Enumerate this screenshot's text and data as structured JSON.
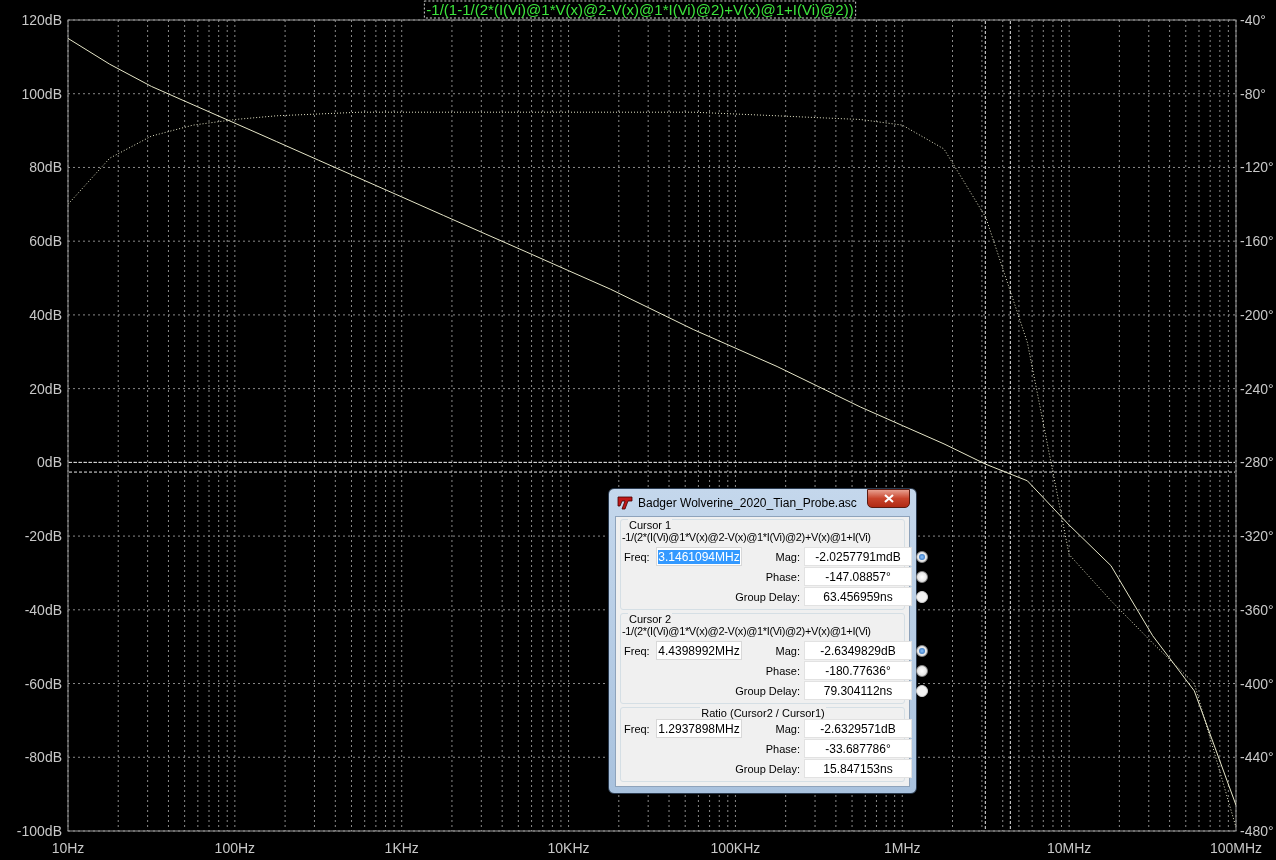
{
  "plot": {
    "title": "-1/(1-1/(2*(I(Vi)@1*V(x)@2-V(x)@1*I(Vi)@2)+V(x)@1+I(Vi)@2))",
    "chart_data": {
      "type": "line",
      "ylim": [
        -100,
        120
      ],
      "y2lim": [
        -480,
        -40
      ],
      "categories": [
        "10Hz",
        null,
        null,
        null,
        "100Hz",
        null,
        null,
        null,
        "1KHz",
        null,
        null,
        null,
        "10KHz",
        null,
        null,
        null,
        "100KHz",
        null,
        null,
        null,
        "1MHz",
        null,
        null,
        null,
        "10MHz",
        null,
        null,
        null,
        "100MHz"
      ],
      "yticks": [
        {
          "value": 120,
          "label": "120dB"
        },
        {
          "value": 100,
          "label": "100dB"
        },
        {
          "value": 80,
          "label": "80dB"
        },
        {
          "value": 60,
          "label": "60dB"
        },
        {
          "value": 40,
          "label": "40dB"
        },
        {
          "value": 20,
          "label": "20dB"
        },
        {
          "value": 0,
          "label": "0dB"
        },
        {
          "value": -20,
          "label": "-20dB"
        },
        {
          "value": -40,
          "label": "-40dB"
        },
        {
          "value": -60,
          "label": "-60dB"
        },
        {
          "value": -80,
          "label": "-80dB"
        },
        {
          "value": -100,
          "label": "-100dB"
        }
      ],
      "y2ticks": [
        {
          "value": -40,
          "label": "-40°"
        },
        {
          "value": -80,
          "label": "-80°"
        },
        {
          "value": -120,
          "label": "-120°"
        },
        {
          "value": -160,
          "label": "-160°"
        },
        {
          "value": -200,
          "label": "-200°"
        },
        {
          "value": -240,
          "label": "-240°"
        },
        {
          "value": -280,
          "label": "-280°"
        },
        {
          "value": -320,
          "label": "-320°"
        },
        {
          "value": -360,
          "label": "-360°"
        },
        {
          "value": -400,
          "label": "-400°"
        },
        {
          "value": -440,
          "label": "-440°"
        },
        {
          "value": -480,
          "label": "-480°"
        }
      ],
      "series": [
        {
          "color": "#e6e6c8",
          "values": [
            115,
            108,
            102,
            97,
            92,
            87,
            82,
            77,
            72,
            67,
            62,
            57,
            52,
            47,
            41.5,
            36,
            31,
            26,
            20.5,
            15,
            10,
            5,
            -0.5,
            -5,
            -17,
            -28,
            -47,
            -62,
            -93
          ]
        },
        {
          "axis": "y2",
          "line_style": "dotted",
          "color": "#e6e6c8",
          "values": [
            -140,
            -115,
            -103,
            -97,
            -94,
            -92,
            -91,
            -90,
            -90,
            -90,
            -90,
            -90,
            -90,
            -90,
            -90,
            -90,
            -91,
            -92,
            -93,
            -94,
            -97,
            -110,
            -147,
            -215,
            -330,
            -355,
            -378,
            -400,
            -478
          ]
        }
      ],
      "grid": true
    }
  },
  "cursor_dialog": {
    "title": "Badger Wolverine_2020_Tian_Probe.asc",
    "sections": [
      {
        "kind": "cursor",
        "heading": "Cursor 1",
        "expression": "-1/(2*(I(Vi)@1*V(x)@2-V(x)@1*I(Vi)@2)+V(x)@1+I(Vi)",
        "freq": {
          "label": "Freq:",
          "value": "3.1461094MHz",
          "text_selected": true
        },
        "readouts": [
          {
            "label": "Mag:",
            "value": "-2.0257791mdB",
            "selected": true,
            "disabled": false
          },
          {
            "label": "Phase:",
            "value": "-147.08857°",
            "selected": false,
            "disabled": false
          },
          {
            "label": "Group Delay:",
            "value": "63.456959ns",
            "selected": false,
            "disabled": true
          }
        ]
      },
      {
        "kind": "cursor",
        "heading": "Cursor 2",
        "expression": "-1/(2*(I(Vi)@1*V(x)@2-V(x)@1*I(Vi)@2)+V(x)@1+I(Vi)",
        "freq": {
          "label": "Freq:",
          "value": "4.4398992MHz",
          "text_selected": false
        },
        "readouts": [
          {
            "label": "Mag:",
            "value": "-2.6349829dB",
            "selected": true,
            "disabled": false
          },
          {
            "label": "Phase:",
            "value": "-180.77636°",
            "selected": false,
            "disabled": false
          },
          {
            "label": "Group Delay:",
            "value": "79.304112ns",
            "selected": false,
            "disabled": true
          }
        ]
      },
      {
        "kind": "ratio",
        "heading": "Ratio (Cursor2 / Cursor1)",
        "freq": {
          "label": "Freq:",
          "value": "1.2937898MHz",
          "text_selected": false
        },
        "readouts": [
          {
            "label": "Mag:",
            "value": "-2.6329571dB"
          },
          {
            "label": "Phase:",
            "value": "-33.687786°"
          },
          {
            "label": "Group Delay:",
            "value": "15.847153ns"
          }
        ]
      }
    ]
  }
}
